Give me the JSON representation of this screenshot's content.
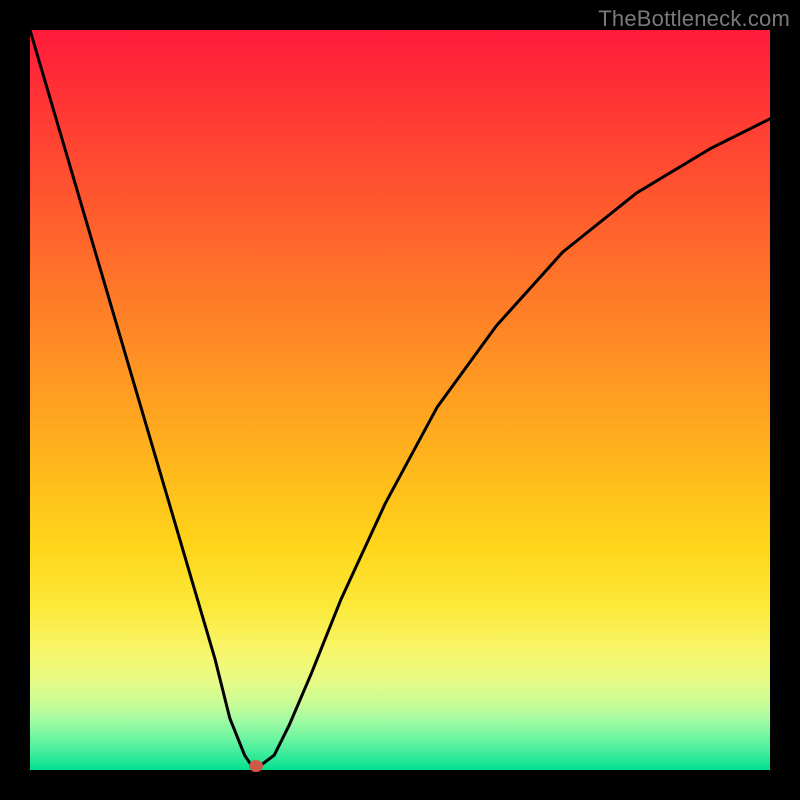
{
  "watermark": "TheBottleneck.com",
  "chart_data": {
    "type": "line",
    "title": "",
    "xlabel": "",
    "ylabel": "",
    "xlim": [
      0,
      1
    ],
    "ylim": [
      0,
      1
    ],
    "background_gradient": {
      "top": "#ff1a3a",
      "bottom": "#00e090",
      "description": "vertical red-to-green gradient (bottleneck severity scale)"
    },
    "series": [
      {
        "name": "bottleneck-curve",
        "x": [
          0.0,
          0.05,
          0.1,
          0.15,
          0.2,
          0.25,
          0.27,
          0.29,
          0.3,
          0.31,
          0.33,
          0.35,
          0.38,
          0.42,
          0.48,
          0.55,
          0.63,
          0.72,
          0.82,
          0.92,
          1.0
        ],
        "y": [
          1.0,
          0.83,
          0.66,
          0.49,
          0.32,
          0.15,
          0.07,
          0.02,
          0.005,
          0.005,
          0.02,
          0.06,
          0.13,
          0.23,
          0.36,
          0.49,
          0.6,
          0.7,
          0.78,
          0.84,
          0.88
        ]
      }
    ],
    "annotations": [
      {
        "name": "minimum-marker",
        "x": 0.305,
        "y": 0.005,
        "color": "#cc5a4a",
        "shape": "ellipse"
      }
    ]
  }
}
